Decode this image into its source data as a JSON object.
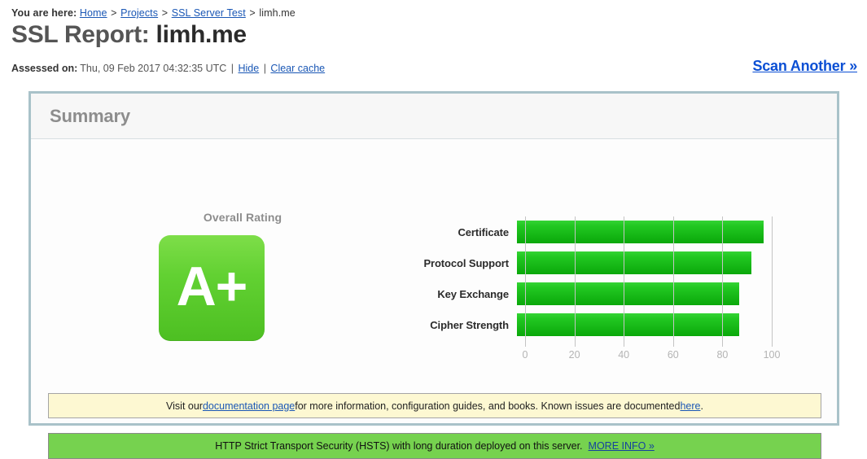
{
  "breadcrumb": {
    "label": "You are here:",
    "items": [
      {
        "text": "Home",
        "link": true
      },
      {
        "text": "Projects",
        "link": true
      },
      {
        "text": "SSL Server Test",
        "link": true
      },
      {
        "text": "limh.me",
        "link": false
      }
    ],
    "separator": ">"
  },
  "header": {
    "title_prefix": "SSL Report:",
    "host": "limh.me",
    "assessed_label": "Assessed on:",
    "assessed_value": "Thu, 09 Feb 2017 04:32:35 UTC",
    "hide_link": "Hide",
    "clear_cache_link": "Clear cache",
    "pipe": "|",
    "scan_another": "Scan Another »"
  },
  "panel": {
    "title": "Summary",
    "rating_caption": "Overall Rating",
    "grade": "A+",
    "grade_color": "#62d132"
  },
  "chart_data": {
    "type": "bar",
    "orientation": "horizontal",
    "title": "",
    "categories": [
      "Certificate",
      "Protocol Support",
      "Key Exchange",
      "Cipher Strength"
    ],
    "values": [
      100,
      95,
      90,
      90
    ],
    "xlabel": "",
    "ylabel": "",
    "xlim": [
      0,
      100
    ],
    "ticks": [
      0,
      20,
      40,
      60,
      80,
      100
    ],
    "tick_labels": [
      "0",
      "20",
      "40",
      "60",
      "80",
      "100"
    ],
    "grid": true,
    "legend": "none",
    "bar_color": "#22c822"
  },
  "notices": {
    "documentation": {
      "text_before": "Visit our ",
      "link1": "documentation page",
      "text_middle": " for more information, configuration guides, and books. Known issues are documented ",
      "link2": "here",
      "text_after": "."
    },
    "hsts": {
      "text": "HTTP Strict Transport Security (HSTS) with long duration deployed on this server.",
      "link": "MORE INFO »"
    }
  }
}
